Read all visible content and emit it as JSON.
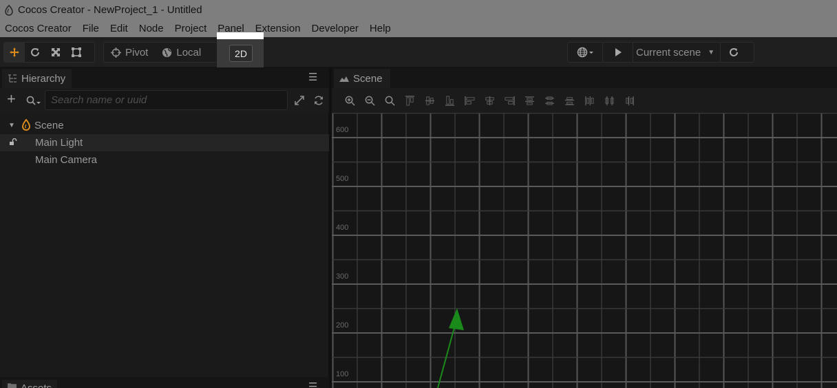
{
  "window": {
    "title": "Cocos Creator - NewProject_1 - Untitled"
  },
  "menubar": {
    "items": [
      "Cocos Creator",
      "File",
      "Edit",
      "Node",
      "Project",
      "Panel",
      "Extension",
      "Developer",
      "Help"
    ]
  },
  "toolbar": {
    "pivot_label": "Pivot",
    "local_label": "Local",
    "mode_2d_label": "2D",
    "scene_select_value": "Current scene"
  },
  "hierarchy": {
    "tab_label": "Hierarchy",
    "search_placeholder": "Search name or uuid",
    "tree": [
      {
        "label": "Scene",
        "type": "scene",
        "expanded": true
      },
      {
        "label": "Main Light",
        "type": "node",
        "selected": true,
        "locked": true
      },
      {
        "label": "Main Camera",
        "type": "node"
      }
    ]
  },
  "assets": {
    "tab_label": "Assets"
  },
  "scene": {
    "tab_label": "Scene",
    "ruler_labels": [
      "600",
      "500",
      "400",
      "300",
      "200",
      "100"
    ],
    "gizmo_color": "#1a8a1a",
    "grid_color": "#5a5a5a"
  },
  "colors": {
    "accent_orange": "#d98a1c",
    "highlight": "#ffffff"
  }
}
